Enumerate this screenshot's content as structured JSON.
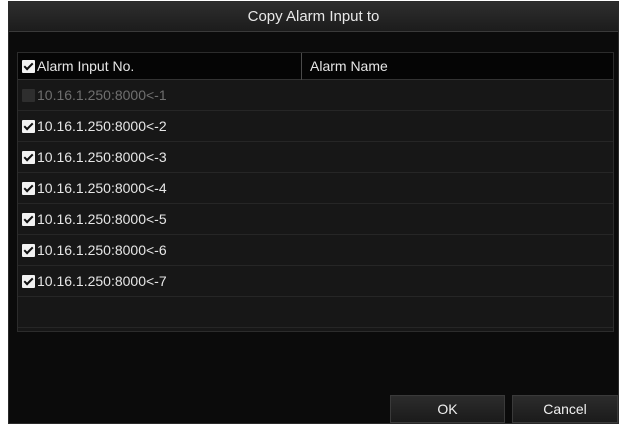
{
  "dialog": {
    "title": "Copy Alarm Input to"
  },
  "table": {
    "headers": {
      "alarm_input_no": "Alarm Input No.",
      "alarm_name": "Alarm Name"
    },
    "rows": [
      {
        "label": "10.16.1.250:8000<-1",
        "checked": false,
        "disabled": true
      },
      {
        "label": "10.16.1.250:8000<-2",
        "checked": true,
        "disabled": false
      },
      {
        "label": "10.16.1.250:8000<-3",
        "checked": true,
        "disabled": false
      },
      {
        "label": "10.16.1.250:8000<-4",
        "checked": true,
        "disabled": false
      },
      {
        "label": "10.16.1.250:8000<-5",
        "checked": true,
        "disabled": false
      },
      {
        "label": "10.16.1.250:8000<-6",
        "checked": true,
        "disabled": false
      },
      {
        "label": "10.16.1.250:8000<-7",
        "checked": true,
        "disabled": false
      }
    ]
  },
  "buttons": {
    "ok_label": "OK",
    "cancel_label": "Cancel"
  },
  "colors": {
    "dialog_background": "#0b0b0b",
    "table_background": "#171717",
    "text": "#e6e6e6",
    "disabled_text": "#6f6f6f"
  }
}
